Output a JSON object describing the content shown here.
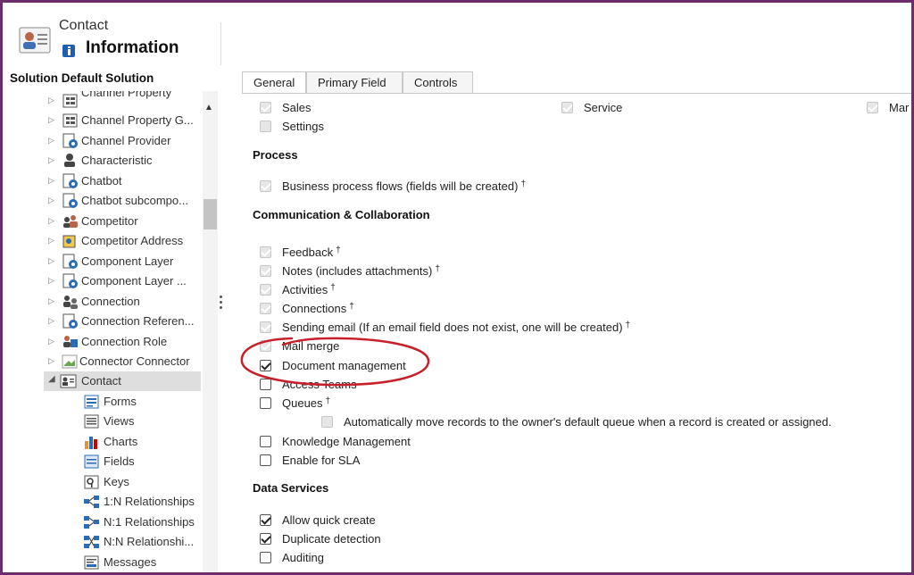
{
  "header": {
    "entity_label": "Contact",
    "title": "Information"
  },
  "left_panel": {
    "solution_label": "Solution Default Solution",
    "tree_items": [
      {
        "label": "Channel Property",
        "icon": "entity-grid-icon"
      },
      {
        "label": "Channel Property G...",
        "icon": "entity-grid-icon"
      },
      {
        "label": "Channel Provider",
        "icon": "entity-gear-icon"
      },
      {
        "label": "Characteristic",
        "icon": "person-icon"
      },
      {
        "label": "Chatbot",
        "icon": "entity-gear-icon"
      },
      {
        "label": "Chatbot subcompo...",
        "icon": "entity-gear-icon"
      },
      {
        "label": "Competitor",
        "icon": "people-icon"
      },
      {
        "label": "Competitor Address",
        "icon": "address-icon"
      },
      {
        "label": "Component Layer",
        "icon": "entity-gear-icon"
      },
      {
        "label": "Component Layer ...",
        "icon": "entity-gear-icon"
      },
      {
        "label": "Connection",
        "icon": "people-icon"
      },
      {
        "label": "Connection Referen...",
        "icon": "entity-gear-icon"
      },
      {
        "label": "Connection Role",
        "icon": "connection-role-icon"
      },
      {
        "label": "Connector Connector",
        "icon": "broken-image-icon"
      },
      {
        "label": "Contact",
        "icon": "contact-card-icon"
      }
    ],
    "sub_items": [
      {
        "label": "Forms",
        "icon": "forms-icon"
      },
      {
        "label": "Views",
        "icon": "views-icon"
      },
      {
        "label": "Charts",
        "icon": "charts-icon"
      },
      {
        "label": "Fields",
        "icon": "fields-icon"
      },
      {
        "label": "Keys",
        "icon": "keys-icon"
      },
      {
        "label": "1:N Relationships",
        "icon": "relationship-icon"
      },
      {
        "label": "N:1 Relationships",
        "icon": "relationship-icon"
      },
      {
        "label": "N:N Relationshi...",
        "icon": "relationship-icon"
      },
      {
        "label": "Messages",
        "icon": "messages-icon"
      }
    ]
  },
  "tabs": [
    "General",
    "Primary Field",
    "Controls"
  ],
  "areas": {
    "sales": "Sales",
    "service": "Service",
    "marketing_partial": "Mar",
    "settings": "Settings"
  },
  "sections": {
    "process": "Process",
    "communication": "Communication & Collaboration",
    "data_services": "Data Services"
  },
  "process": {
    "bpf": "Business process flows (fields will be created)",
    "dagger": "†"
  },
  "communication": {
    "feedback": "Feedback",
    "notes": "Notes (includes attachments)",
    "activities": "Activities",
    "connections": "Connections",
    "sending_email": "Sending email (If an email field does not exist, one will be created)",
    "mail_merge": "Mail merge",
    "document_management": "Document management",
    "access_teams": "Access Teams",
    "queues": "Queues",
    "auto_move": "Automatically move records to the owner's default queue when a record is created or assigned.",
    "knowledge": "Knowledge Management",
    "sla": "Enable for SLA"
  },
  "data_services": {
    "quick_create": "Allow quick create",
    "duplicate": "Duplicate detection",
    "auditing": "Auditing"
  },
  "colors": {
    "frame": "#6b2d6b",
    "annotation": "#c8202a",
    "selected_bg": "#dedede"
  }
}
